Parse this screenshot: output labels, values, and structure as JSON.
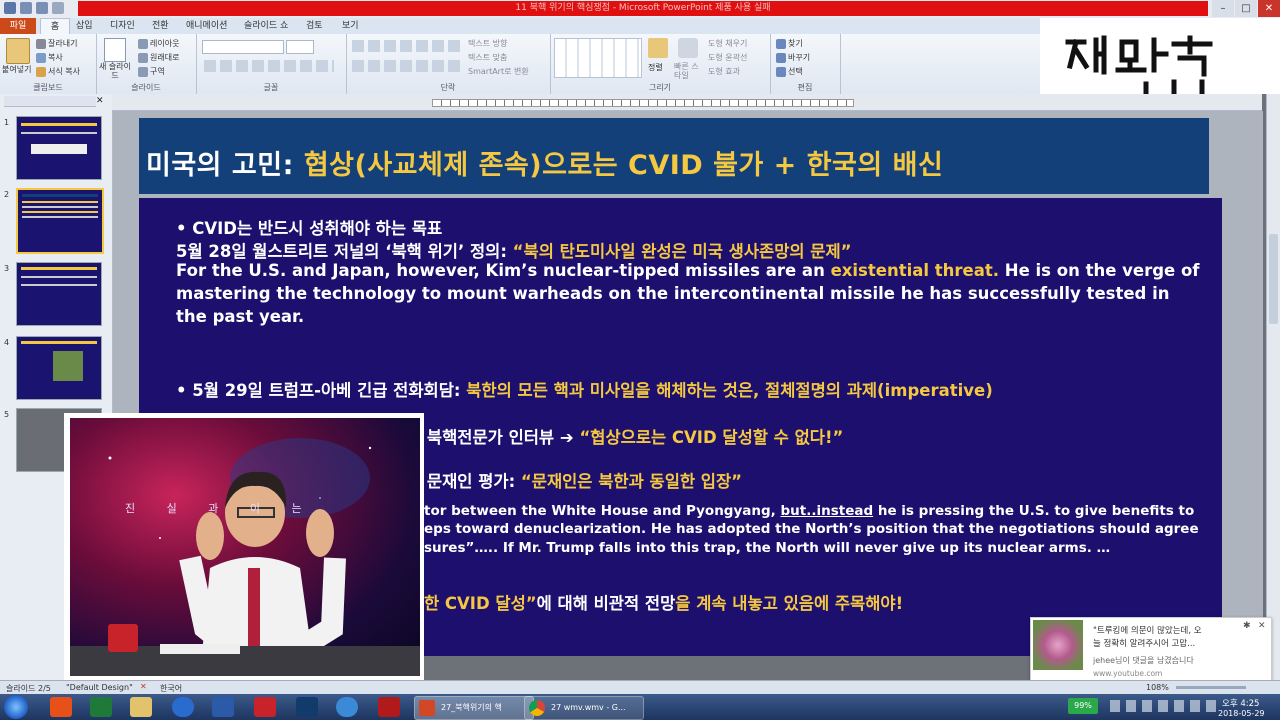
{
  "window": {
    "title": "11 북핵 위기의 핵심쟁점 - Microsoft PowerPoint 제품 사용 실패",
    "min_label": "–",
    "max_label": "□",
    "close_label": "✕"
  },
  "ribbon": {
    "tabs": [
      "파일",
      "홈",
      "삽입",
      "디자인",
      "전환",
      "애니메이션",
      "슬라이드 쇼",
      "검토",
      "보기"
    ],
    "groups": {
      "clipboard": {
        "label": "클립보드",
        "paste": "붙여넣기",
        "cut": "잘라내기",
        "copy": "복사",
        "format_painter": "서식 복사"
      },
      "slides": {
        "label": "슬라이드",
        "new_slide": "새 슬라이드",
        "layout": "레이아웃",
        "reset": "원래대로",
        "section": "구역"
      },
      "font": {
        "label": "글꼴"
      },
      "paragraph": {
        "label": "단락",
        "text_direction": "텍스트 방향",
        "align_text": "텍스트 맞춤",
        "smartart": "SmartArt로 변환"
      },
      "drawing": {
        "label": "그리기",
        "arrange": "정렬",
        "quick_styles": "빠른 스타일",
        "shape_fill": "도형 채우기",
        "shape_outline": "도형 윤곽선",
        "shape_effects": "도형 효과"
      },
      "editing": {
        "label": "편집",
        "find": "찾기",
        "replace": "바꾸기",
        "select": "선택"
      }
    }
  },
  "slide_pane": {
    "numbers": [
      "1",
      "2",
      "3",
      "4",
      "5"
    ]
  },
  "slide": {
    "title_prefix": "미국의 고민: ",
    "title_highlight": "협상(사교체제 존속)으로는 CVID 불가 + 한국의 배신",
    "bullet1": "•  CVID는 반드시 성취해야 하는 목표",
    "line2_a": "5월 28일 월스트리트 저널의 ‘북핵 위기’ 정의:  ",
    "line2_b": "“북의 탄도미사일 완성은 미국 생사존망의 문제”",
    "line3_a": "For the U.S. and Japan, however, Kim’s nuclear-tipped missiles are an ",
    "line3_b": "existential threat.",
    "line3_c": " He is on the verge of",
    "line4": "mastering the technology to mount warheads on the intercontinental missile he has successfully tested in",
    "line5": "the past year.",
    "bullet2_a": "•  5월 29일 트럼프-아베 긴급 전화회담: ",
    "bullet2_b": "북한의 모든 핵과 미사일을 해체하는 것은, 절체절명의 과제(imperative)",
    "line7_a": "령 북핵전문가 인터뷰 ➔ ",
    "line7_b": "“협상으로는 CVID 달성할 수 없다!”",
    "line8_a": "의 문재인 평가: ",
    "line8_b": "“문재인은 북한과 동일한 입장”",
    "line9_a": "tor between the White House and Pyongyang, ",
    "line9_b": "but..instead",
    "line9_c": " he is pressing the U.S. to give benefits to",
    "line10": "eps toward denuclearization. He has adopted the North’s position that the negotiations should agree",
    "line11": "sures”….. If Mr. Trump falls into this trap, the North will never give up its nuclear arms. …",
    "line12_a": "한 CVID 달성”",
    "line12_b": "에 대해 비관적 전망",
    "line12_c": "을 계속 내놓고 있음에 주목해야!"
  },
  "webcam": {
    "overlay_text": "진 실 과  이 는"
  },
  "status_bar": {
    "slide_info": "슬라이드 2/5",
    "theme": "\"Default Design\"",
    "language": "한국어",
    "zoom": "108%"
  },
  "notification": {
    "line1": "\"트루킹에 의문이 많았는데, 오",
    "line2": "늘 정확히 알려주시어 고맙...",
    "line3": "jehee님이 댓글을 남겼습니다",
    "source": "www.youtube.com"
  },
  "taskbar": {
    "ppt_label": "27_북핵위기의 핵",
    "chrome_label": "27 wmv.wmv - G...",
    "battery": "99%",
    "time": "오후 4:25",
    "date": "2018-05-29"
  },
  "colors": {
    "accent_yellow": "#f5c842",
    "slide_bg": "#1c0f6e",
    "title_bg": "#14407a",
    "title_bar_red": "#e01010"
  }
}
